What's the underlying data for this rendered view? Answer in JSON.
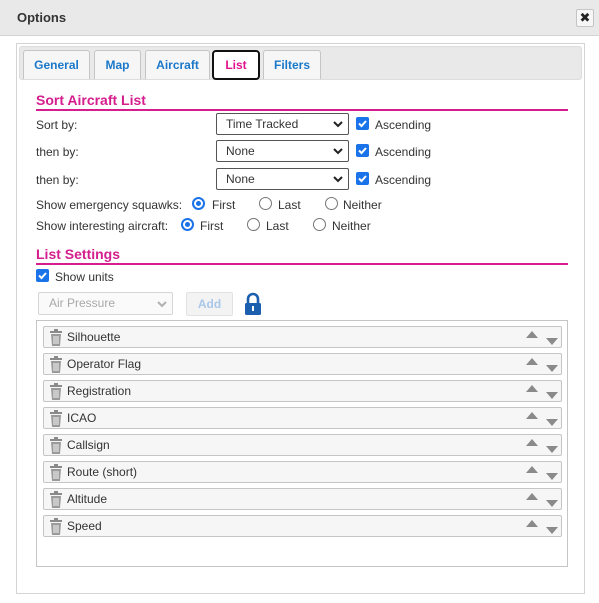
{
  "dialog": {
    "title": "Options",
    "close_glyph": "✖"
  },
  "tabs": [
    {
      "label": "General"
    },
    {
      "label": "Map"
    },
    {
      "label": "Aircraft"
    },
    {
      "label": "List",
      "active": true
    },
    {
      "label": "Filters"
    }
  ],
  "sort_section": {
    "title": "Sort Aircraft List",
    "rows": [
      {
        "label": "Sort by:",
        "value": "Time Tracked",
        "ascending_label": "Ascending",
        "ascending": true
      },
      {
        "label": "then by:",
        "value": "None",
        "ascending_label": "Ascending",
        "ascending": true
      },
      {
        "label": "then by:",
        "value": "None",
        "ascending_label": "Ascending",
        "ascending": true
      }
    ],
    "emergency": {
      "label": "Show emergency squawks:",
      "options": [
        "First",
        "Last",
        "Neither"
      ],
      "selected": "First"
    },
    "interesting": {
      "label": "Show interesting aircraft:",
      "options": [
        "First",
        "Last",
        "Neither"
      ],
      "selected": "First"
    }
  },
  "list_section": {
    "title": "List Settings",
    "show_units_label": "Show units",
    "show_units": true,
    "column_select": "Air Pressure",
    "add_label": "Add",
    "lock_icon": "lock-icon",
    "columns": [
      "Silhouette",
      "Operator Flag",
      "Registration",
      "ICAO",
      "Callsign",
      "Route (short)",
      "Altitude",
      "Speed"
    ]
  },
  "colors": {
    "accent": "#d51d8d",
    "link": "#1b78c9",
    "control": "#1a73e8"
  }
}
